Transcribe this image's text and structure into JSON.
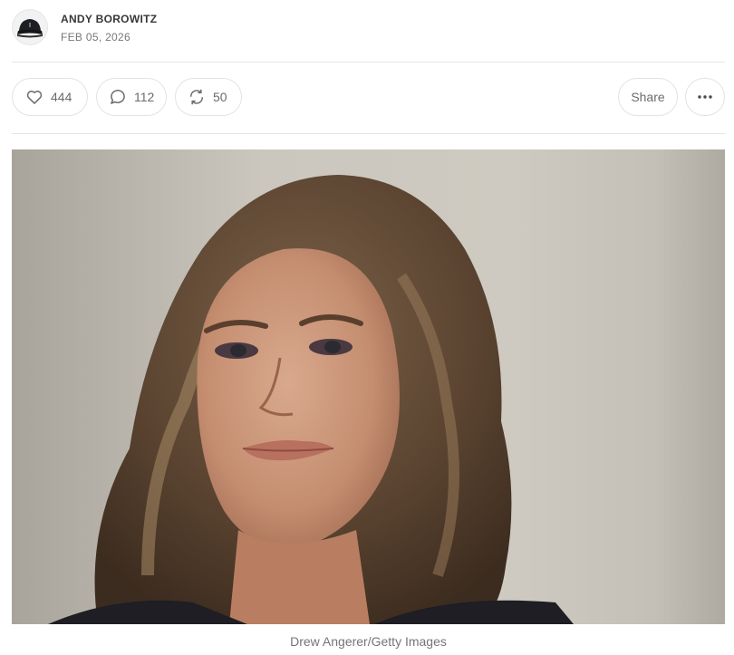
{
  "byline": {
    "author": "ANDY BOROWITZ",
    "date": "FEB 05, 2026"
  },
  "actions": {
    "likes": "444",
    "comments": "112",
    "restacks": "50",
    "share_label": "Share"
  },
  "post_image": {
    "caption": "Drew Angerer/Getty Images"
  },
  "colors": {
    "text": "#363737",
    "muted": "#757575",
    "border": "#e3e3e3"
  }
}
